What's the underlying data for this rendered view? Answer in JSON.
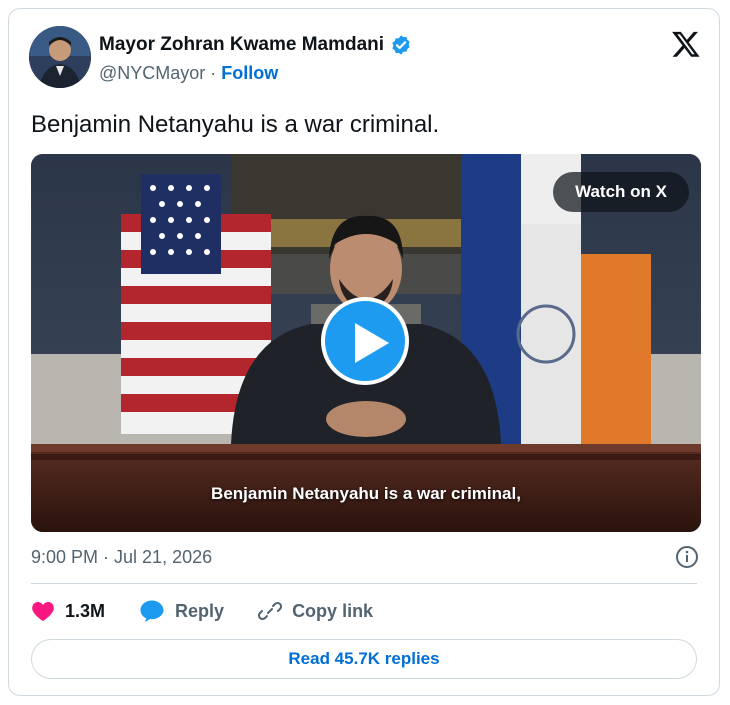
{
  "author": {
    "display_name": "Mayor Zohran Kwame Mamdani",
    "handle": "@NYCMayor",
    "separator": " · ",
    "follow_label": "Follow",
    "verified_icon": "verified-badge-icon"
  },
  "platform_icon": "x-logo-icon",
  "tweet": {
    "text": "Benjamin Netanyahu is a war criminal."
  },
  "media": {
    "watch_label": "Watch on X",
    "caption": "Benjamin Netanyahu is a war criminal,",
    "play_icon": "play-icon"
  },
  "timestamp": "9:00 PM · Jul 21, 2026",
  "actions": {
    "like_count": "1.3M",
    "reply_label": "Reply",
    "copy_link_label": "Copy link"
  },
  "read_replies_label": "Read 45.7K replies",
  "colors": {
    "accent": "#1d9bf0",
    "link": "#006fd6",
    "like": "#f91880",
    "muted": "#536471",
    "border": "#cfd9de"
  }
}
